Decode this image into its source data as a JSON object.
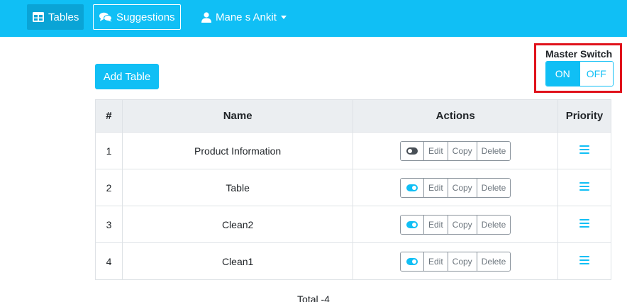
{
  "nav": {
    "tables_label": "Tables",
    "suggestions_label": "Suggestions",
    "user_label": "Mane s Ankit"
  },
  "toolbar": {
    "add_table_label": "Add Table"
  },
  "master_switch": {
    "label": "Master Switch",
    "on_label": "ON",
    "off_label": "OFF",
    "selected": "ON"
  },
  "table": {
    "headers": {
      "num": "#",
      "name": "Name",
      "actions": "Actions",
      "priority": "Priority"
    },
    "action_labels": {
      "edit": "Edit",
      "copy": "Copy",
      "delete": "Delete"
    },
    "rows": [
      {
        "num": "1",
        "name": "Product Information",
        "toggle": "off"
      },
      {
        "num": "2",
        "name": "Table",
        "toggle": "on"
      },
      {
        "num": "3",
        "name": "Clean2",
        "toggle": "on"
      },
      {
        "num": "4",
        "name": "Clean1",
        "toggle": "on"
      }
    ]
  },
  "footer": {
    "total": "Total -4"
  },
  "colors": {
    "primary": "#10bff5",
    "navbar_active": "#0aa4d6",
    "highlight_box": "#e0121b",
    "header_bg": "#ebeef1"
  },
  "icons": {
    "tables": "table-icon",
    "suggestions": "comments-icon",
    "user": "user-icon",
    "priority": "hamburger-icon"
  }
}
